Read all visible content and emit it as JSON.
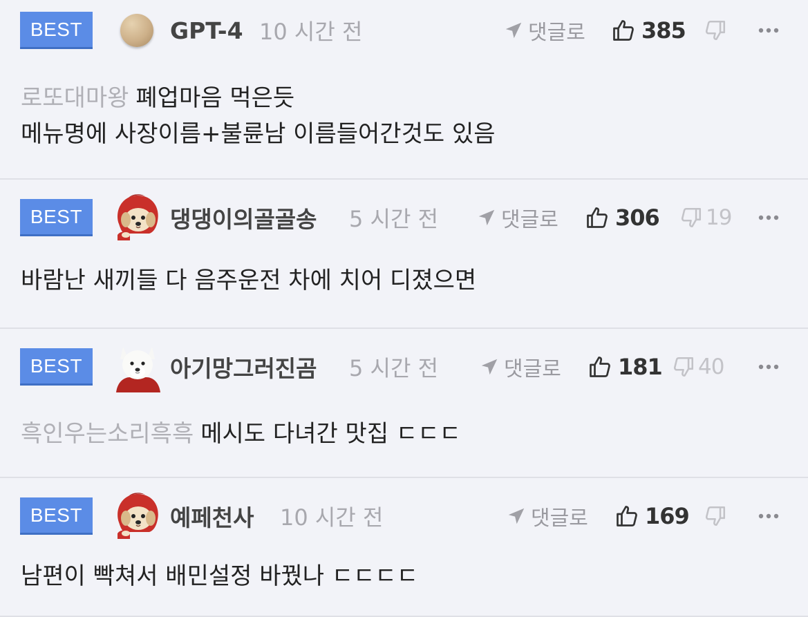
{
  "comments": [
    {
      "badge": "BEST",
      "avatar": "beige-ball-avatar",
      "nickname": "GPT-4",
      "time": "10 시간 전",
      "reply_label": "댓글로",
      "likes": "385",
      "dislikes": "",
      "mention": "로또대마왕",
      "lines": [
        "폐업마음 먹은듯",
        "메뉴명에 사장이름+불륜남 이름들어간것도 있음"
      ]
    },
    {
      "badge": "BEST",
      "avatar": "puppy-red-hood-avatar",
      "nickname": "댕댕이의골골송",
      "time": "5 시간 전",
      "reply_label": "댓글로",
      "likes": "306",
      "dislikes": "19",
      "mention": "",
      "lines": [
        "바람난 새끼들 다 음주운전 차에 치어 디졌으면"
      ]
    },
    {
      "badge": "BEST",
      "avatar": "white-dog-red-hood-avatar",
      "nickname": "아기망그러진곰",
      "time": "5 시간 전",
      "reply_label": "댓글로",
      "likes": "181",
      "dislikes": "40",
      "mention": "흑인우는소리흑흑",
      "lines": [
        "메시도 다녀간 맛집 ㄷㄷㄷ"
      ]
    },
    {
      "badge": "BEST",
      "avatar": "puppy-red-hood-avatar",
      "nickname": "예페천사",
      "time": "10 시간 전",
      "reply_label": "댓글로",
      "likes": "169",
      "dislikes": "",
      "mention": "",
      "lines": [
        "남편이 빡쳐서 배민설정 바꿨나 ㄷㄷㄷㄷ"
      ]
    }
  ],
  "colors": {
    "background": "#f2f3f8",
    "badge": "#5b8ce6",
    "divider": "#dfe0e6",
    "mention": "#b0b0b6",
    "meta": "#a8a8ae"
  }
}
